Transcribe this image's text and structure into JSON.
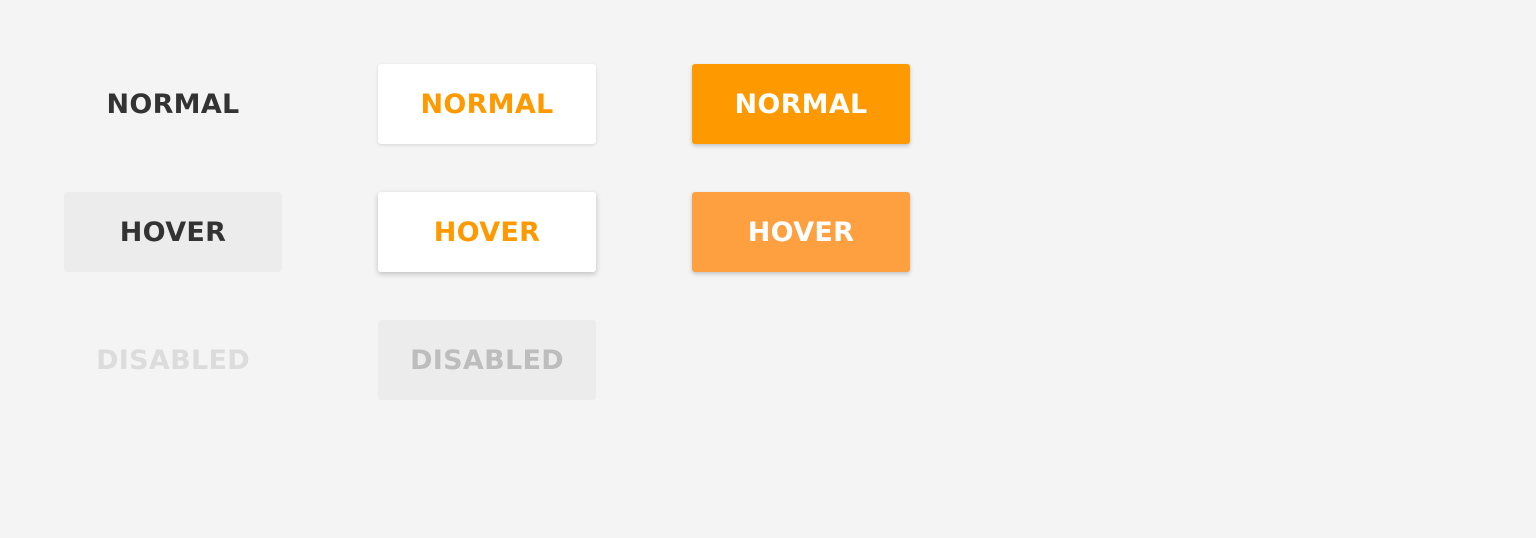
{
  "colors": {
    "background": "#f4f4f4",
    "accent": "#ff9900",
    "accent_hover": "#ffa040",
    "text_dark": "#333333",
    "disabled_text": "#bdbdbd"
  },
  "flat_buttons": {
    "normal": "NORMAL",
    "hover": "HOVER",
    "disabled": "DISABLED"
  },
  "raised_buttons": {
    "normal": "NORMAL",
    "hover": "HOVER",
    "disabled": "DISABLED"
  },
  "primary_buttons": {
    "normal": "NORMAL",
    "hover": "HOVER"
  }
}
